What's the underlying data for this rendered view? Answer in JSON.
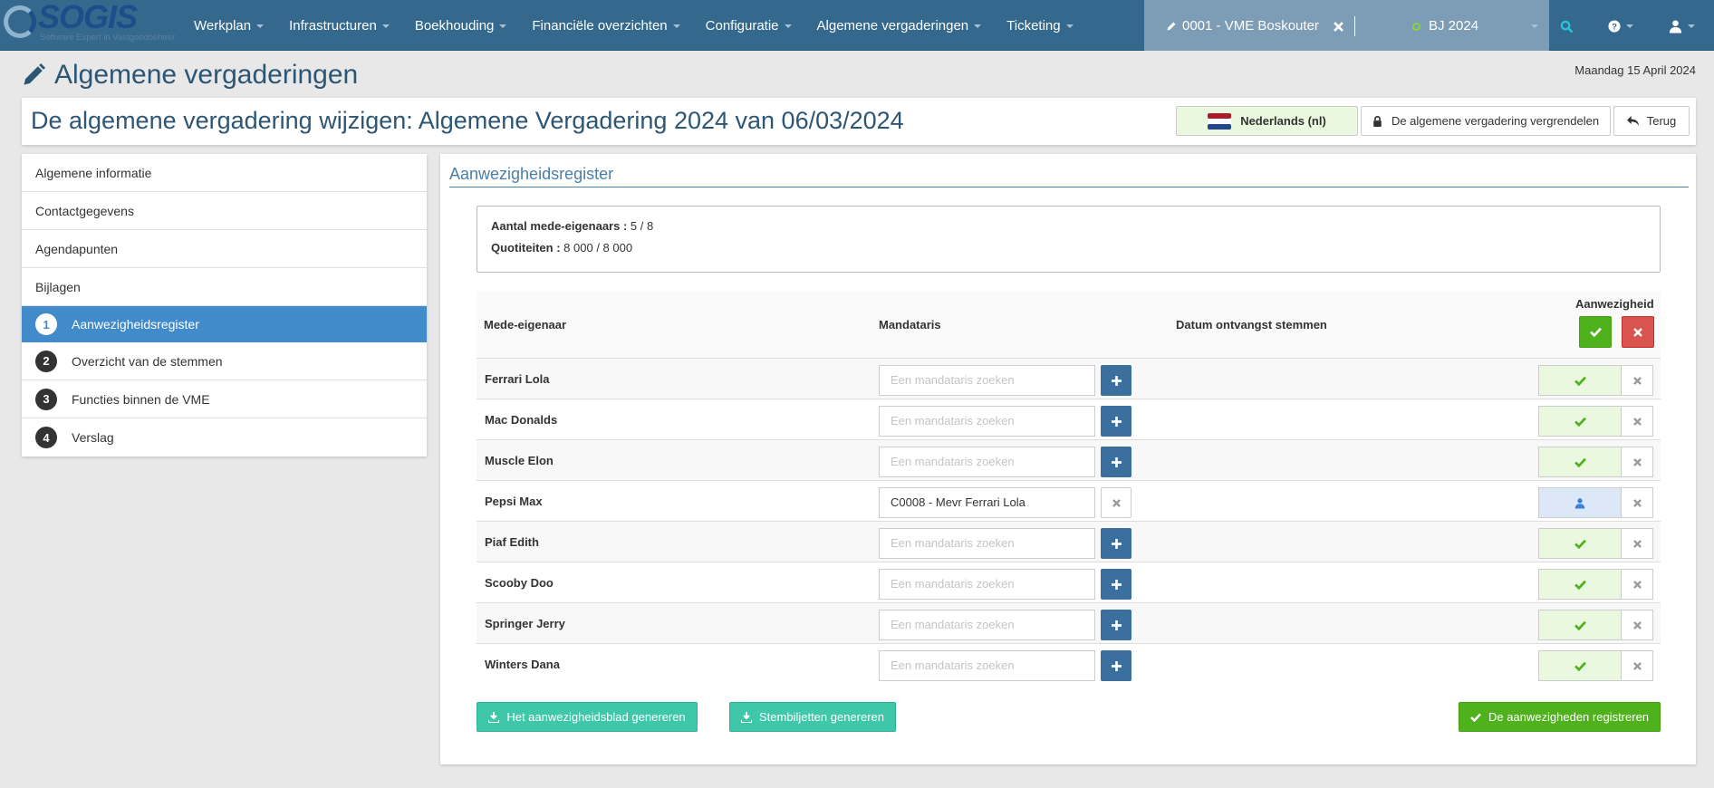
{
  "nav": {
    "logo_text": "SOGIS",
    "logo_tagline": "Software Expert in Vastgoedbeheer",
    "menu": [
      "Werkplan",
      "Infrastructuren",
      "Boekhouding",
      "Financiële overzichten",
      "Configuratie",
      "Algemene vergaderingen",
      "Ticketing"
    ],
    "vme": "0001 - VME Boskouter",
    "bj": "BJ 2024"
  },
  "page": {
    "title": "Algemene vergaderingen",
    "date": "Maandag 15 April 2024",
    "subtitle": "De algemene vergadering wijzigen: Algemene Vergadering 2024 van 06/03/2024",
    "lang_btn": "Nederlands (nl)",
    "lock_btn": "De algemene vergadering vergrendelen",
    "back_btn": "Terug"
  },
  "sidebar": {
    "items": [
      {
        "label": "Algemene informatie"
      },
      {
        "label": "Contactgegevens"
      },
      {
        "label": "Agendapunten"
      },
      {
        "label": "Bijlagen"
      },
      {
        "num": "1",
        "label": "Aanwezigheidsregister",
        "active": true
      },
      {
        "num": "2",
        "label": "Overzicht van de stemmen"
      },
      {
        "num": "3",
        "label": "Functies binnen de VME"
      },
      {
        "num": "4",
        "label": "Verslag"
      }
    ]
  },
  "main": {
    "heading": "Aanwezigheidsregister",
    "stat1_label": "Aantal mede-eigenaars :",
    "stat1_value": "5 / 8",
    "stat2_label": "Quotiteiten :",
    "stat2_value": "8 000 / 8 000",
    "col_owner": "Mede-eigenaar",
    "col_mandataris": "Mandataris",
    "col_datum": "Datum ontvangst stemmen",
    "col_aanwezig": "Aanwezigheid",
    "placeholder": "Een mandataris zoeken",
    "rows": [
      {
        "name": "Ferrari Lola",
        "mandataris": "",
        "status": "present"
      },
      {
        "name": "Mac Donalds",
        "mandataris": "",
        "status": "present"
      },
      {
        "name": "Muscle Elon",
        "mandataris": "",
        "status": "present"
      },
      {
        "name": "Pepsi Max",
        "mandataris": "C0008 - Mevr Ferrari Lola",
        "status": "proxy"
      },
      {
        "name": "Piaf Edith",
        "mandataris": "",
        "status": "present"
      },
      {
        "name": "Scooby Doo",
        "mandataris": "",
        "status": "present"
      },
      {
        "name": "Springer Jerry",
        "mandataris": "",
        "status": "present"
      },
      {
        "name": "Winters Dana",
        "mandataris": "",
        "status": "present"
      }
    ],
    "btn_blad": "Het aanwezigheidsblad genereren",
    "btn_stem": "Stembiljetten genereren",
    "btn_register": "De aanwezigheden registreren"
  },
  "colors": {
    "navbar": "#34698d",
    "active": "#428bca",
    "teal": "#3ec8a9",
    "green": "#4fb11b",
    "red": "#d9534f"
  }
}
